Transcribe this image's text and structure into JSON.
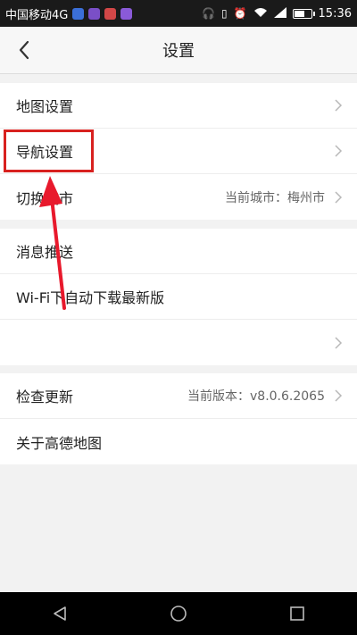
{
  "status_bar": {
    "carrier": "中国移动4G",
    "time": "15:36",
    "signal_label": "4G",
    "battery_level": 0.7,
    "app_icon_colors": [
      "#3b6fd8",
      "#7a4fc7",
      "#d24747",
      "#8a5ad8"
    ]
  },
  "header": {
    "title": "设置"
  },
  "groups": [
    {
      "rows": [
        {
          "label": "地图设置",
          "value": ""
        },
        {
          "label": "导航设置",
          "value": ""
        },
        {
          "label": "切换城市",
          "value": "当前城市：梅州市"
        }
      ]
    },
    {
      "rows": [
        {
          "label": "消息推送",
          "value": ""
        },
        {
          "label": "Wi-Fi下自动下载最新版",
          "value": ""
        },
        {
          "label": "",
          "value": ""
        }
      ]
    },
    {
      "rows": [
        {
          "label": "检查更新",
          "value": "当前版本：v8.0.6.2065"
        },
        {
          "label": "关于高德地图",
          "value": ""
        }
      ]
    }
  ],
  "colors": {
    "highlight": "#d8211f",
    "arrow": "#e8192c"
  }
}
